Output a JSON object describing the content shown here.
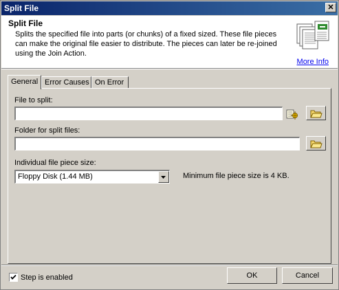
{
  "window": {
    "title": "Split File"
  },
  "header": {
    "title": "Split File",
    "description": "Splits the specified file into parts (or chunks) of a fixed sized.  These file pieces can make the original file easier to distribute.  The pieces can later be re-joined using the Join Action.",
    "more_info": "More Info",
    "icon": "document-pages-icon"
  },
  "tabs": [
    {
      "label": "General",
      "active": true
    },
    {
      "label": "Error Causes",
      "active": false
    },
    {
      "label": "On Error",
      "active": false
    }
  ],
  "general": {
    "file_label": "File to split:",
    "file_value": "",
    "folder_label": "Folder for split files:",
    "folder_value": "",
    "size_label": "Individual file piece size:",
    "size_selected": "Floppy Disk (1.44 MB)",
    "min_note": "Minimum file piece size is 4 KB."
  },
  "footer": {
    "step_enabled_label": "Step is enabled",
    "step_enabled": true,
    "ok_label": "OK",
    "cancel_label": "Cancel"
  },
  "colors": {
    "titlebar_start": "#0a246a",
    "titlebar_end": "#3a6ea5",
    "link": "#0000ee",
    "face": "#d4d0c8"
  }
}
